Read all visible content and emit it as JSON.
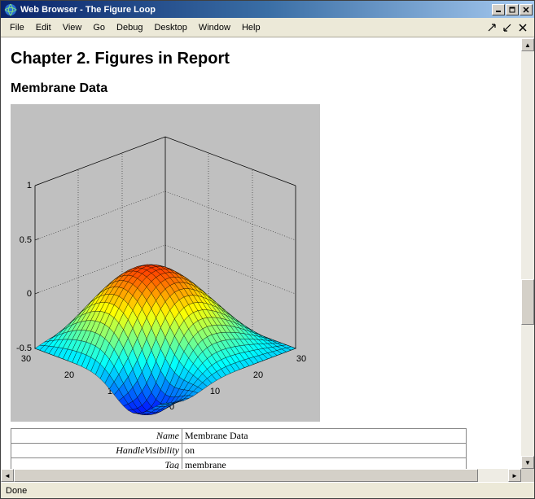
{
  "window": {
    "title": "Web Browser - The Figure Loop",
    "minimize": "_",
    "maximize": "□",
    "close": "×"
  },
  "menu": {
    "items": [
      "File",
      "Edit",
      "View",
      "Go",
      "Debug",
      "Desktop",
      "Window",
      "Help"
    ]
  },
  "doc": {
    "chapter_title": "Chapter 2. Figures in Report",
    "section_title": "Membrane Data"
  },
  "chart_data": {
    "type": "surface",
    "title": "",
    "xlabel": "",
    "ylabel": "",
    "zlabel": "",
    "x_range": [
      0,
      30
    ],
    "y_range": [
      0,
      30
    ],
    "z_range": [
      -0.5,
      1
    ],
    "x_ticks": [
      0,
      10,
      20,
      30
    ],
    "y_ticks": [
      0,
      10,
      20,
      30
    ],
    "z_ticks": [
      -0.5,
      0,
      0.5,
      1
    ],
    "colormap": "jet",
    "grid": true,
    "description": "MATLAB L-shaped membrane eigenfunction surface (peaks-style), colored by height with jet colormap"
  },
  "props": {
    "rows": [
      {
        "key": "Name",
        "val": "Membrane Data"
      },
      {
        "key": "HandleVisibility",
        "val": "on"
      },
      {
        "key": "Tag",
        "val": "membrane"
      }
    ]
  },
  "status": {
    "text": "Done"
  }
}
